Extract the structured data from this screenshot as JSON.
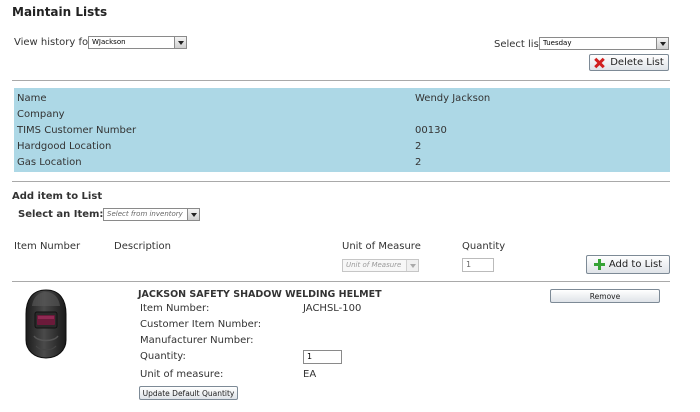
{
  "page": {
    "title": "Maintain Lists"
  },
  "history": {
    "label": "View history for",
    "selected": "WJackson"
  },
  "list_select": {
    "label": "Select list",
    "selected": "Tuesday"
  },
  "delete_button": {
    "label": "Delete List"
  },
  "customer": {
    "rows": [
      {
        "label": "Name",
        "value": "Wendy Jackson"
      },
      {
        "label": "Company",
        "value": ""
      },
      {
        "label": "TIMS Customer Number",
        "value": "00130"
      },
      {
        "label": "Hardgood Location",
        "value": "2"
      },
      {
        "label": "Gas Location",
        "value": "2"
      }
    ]
  },
  "add_item": {
    "heading": "Add item to List",
    "select_label": "Select an Item:",
    "select_placeholder": "Select from inventory",
    "columns": {
      "item_number": "Item Number",
      "description": "Description",
      "unit_of_measure": "Unit of Measure",
      "quantity": "Quantity"
    },
    "uom_placeholder": "Unit of Measure",
    "quantity_value": "1",
    "add_button": "Add to List"
  },
  "item": {
    "title": "JACKSON SAFETY SHADOW WELDING HELMET",
    "fields": [
      {
        "label": "Item Number:",
        "value": "JACHSL-100"
      },
      {
        "label": "Customer Item Number:",
        "value": ""
      },
      {
        "label": "Manufacturer Number:",
        "value": ""
      },
      {
        "label": "Quantity:",
        "value": ""
      },
      {
        "label": "Unit of measure:",
        "value": "EA"
      }
    ],
    "quantity_value": "1",
    "remove_button": "Remove",
    "update_button": "Update Default Quantity",
    "image": "welding-helmet"
  },
  "icons": {
    "delete": "x-icon",
    "add": "plus-icon",
    "dropdown": "chevron-down-icon"
  },
  "colors": {
    "info_panel": "#add8e6",
    "delete_icon": "#d11f1f",
    "add_icon": "#36a336"
  }
}
